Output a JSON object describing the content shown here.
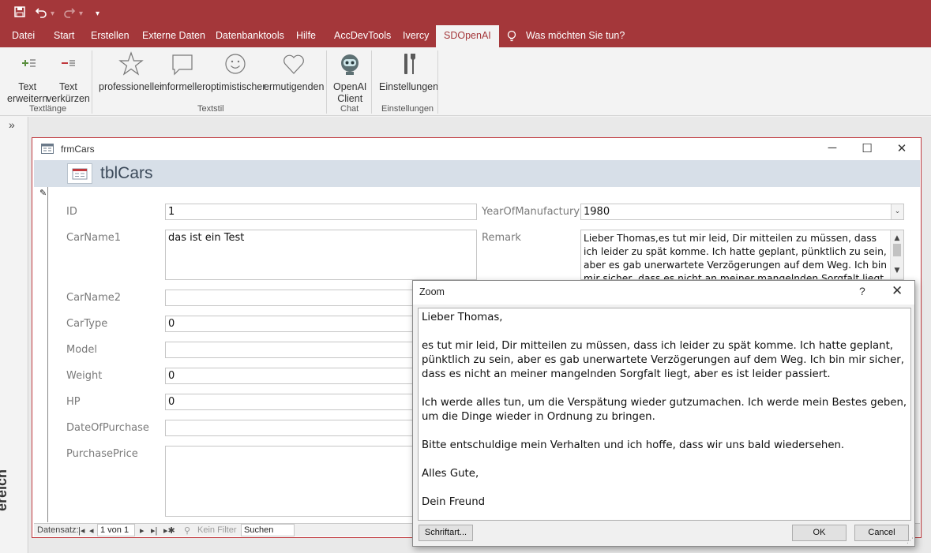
{
  "quick_access": {
    "save_icon": "save-icon",
    "undo_icon": "undo-icon",
    "redo_icon": "redo-icon",
    "customize_icon": "customize-qat-icon"
  },
  "ribbon_tabs": [
    "Datei",
    "Start",
    "Erstellen",
    "Externe Daten",
    "Datenbanktools",
    "Hilfe",
    "AccDevTools",
    "Ivercy",
    "SDOpenAI"
  ],
  "active_tab": "SDOpenAI",
  "tell_me": "Was möchten Sie tun?",
  "ribbon": {
    "text_expand": [
      "Text",
      "erweitern"
    ],
    "text_shorten": [
      "Text",
      "verkürzen"
    ],
    "group_textlaenge": "Textlänge",
    "style_professional": "professioneller",
    "style_informal": "informeller",
    "style_optimistic": "optimistischer",
    "style_encouraging": "ermutigenden",
    "group_textstil": "Textstil",
    "openai_client": [
      "OpenAI",
      "Client"
    ],
    "group_chat": "Chat",
    "settings": "Einstellungen",
    "group_settings": "Einstellungen"
  },
  "nav_pane": {
    "toggle": "»",
    "vertical_label": "ereich"
  },
  "form": {
    "window_title": "frmCars",
    "header_title": "tblCars",
    "fields": {
      "id_label": "ID",
      "id_value": "1",
      "carname1_label": "CarName1",
      "carname1_value": "das ist ein Test",
      "carname2_label": "CarName2",
      "carname2_value": "",
      "cartype_label": "CarType",
      "cartype_value": "0",
      "model_label": "Model",
      "model_value": "",
      "weight_label": "Weight",
      "weight_value": "0",
      "hp_label": "HP",
      "hp_value": "0",
      "dateofpurchase_label": "DateOfPurchase",
      "dateofpurchase_value": "",
      "purchaseprice_label": "PurchasePrice",
      "purchaseprice_value": "",
      "year_label": "YearOfManufactury",
      "year_value": "1980",
      "remark_label": "Remark",
      "remark_value": "Lieber Thomas,es tut mir leid, Dir mitteilen zu müssen, dass ich leider zu spät komme. Ich hatte geplant, pünktlich zu sein, aber es gab unerwartete Verzögerungen auf dem Weg. Ich bin mir sicher, dass es nicht an meiner mangelnden Sorgfalt liegt, aber es ist leider"
    },
    "record_nav": {
      "label": "Datensatz:",
      "position": "1 von 1",
      "filter": "Kein Filter",
      "search": "Suchen"
    }
  },
  "zoom_dialog": {
    "title": "Zoom",
    "help": "?",
    "paragraphs": [
      "Lieber Thomas,",
      "es tut mir leid, Dir mitteilen zu müssen, dass ich leider zu spät komme. Ich hatte geplant, pünktlich zu sein, aber es gab unerwartete Verzögerungen auf dem Weg. Ich bin mir sicher, dass es nicht an meiner mangelnden Sorgfalt liegt, aber es ist leider passiert.",
      "Ich werde alles tun, um die Verspätung wieder gutzumachen. Ich werde mein Bestes geben, um die Dinge wieder in Ordnung zu bringen.",
      "Bitte entschuldige mein Verhalten und ich hoffe, dass wir uns bald wiedersehen.",
      "Alles Gute,",
      "Dein Freund"
    ],
    "font_button": "Schriftart...",
    "ok_button": "OK",
    "cancel_button": "Cancel"
  },
  "colors": {
    "accent": "#a4373a",
    "header_band": "#d7dfe8"
  }
}
